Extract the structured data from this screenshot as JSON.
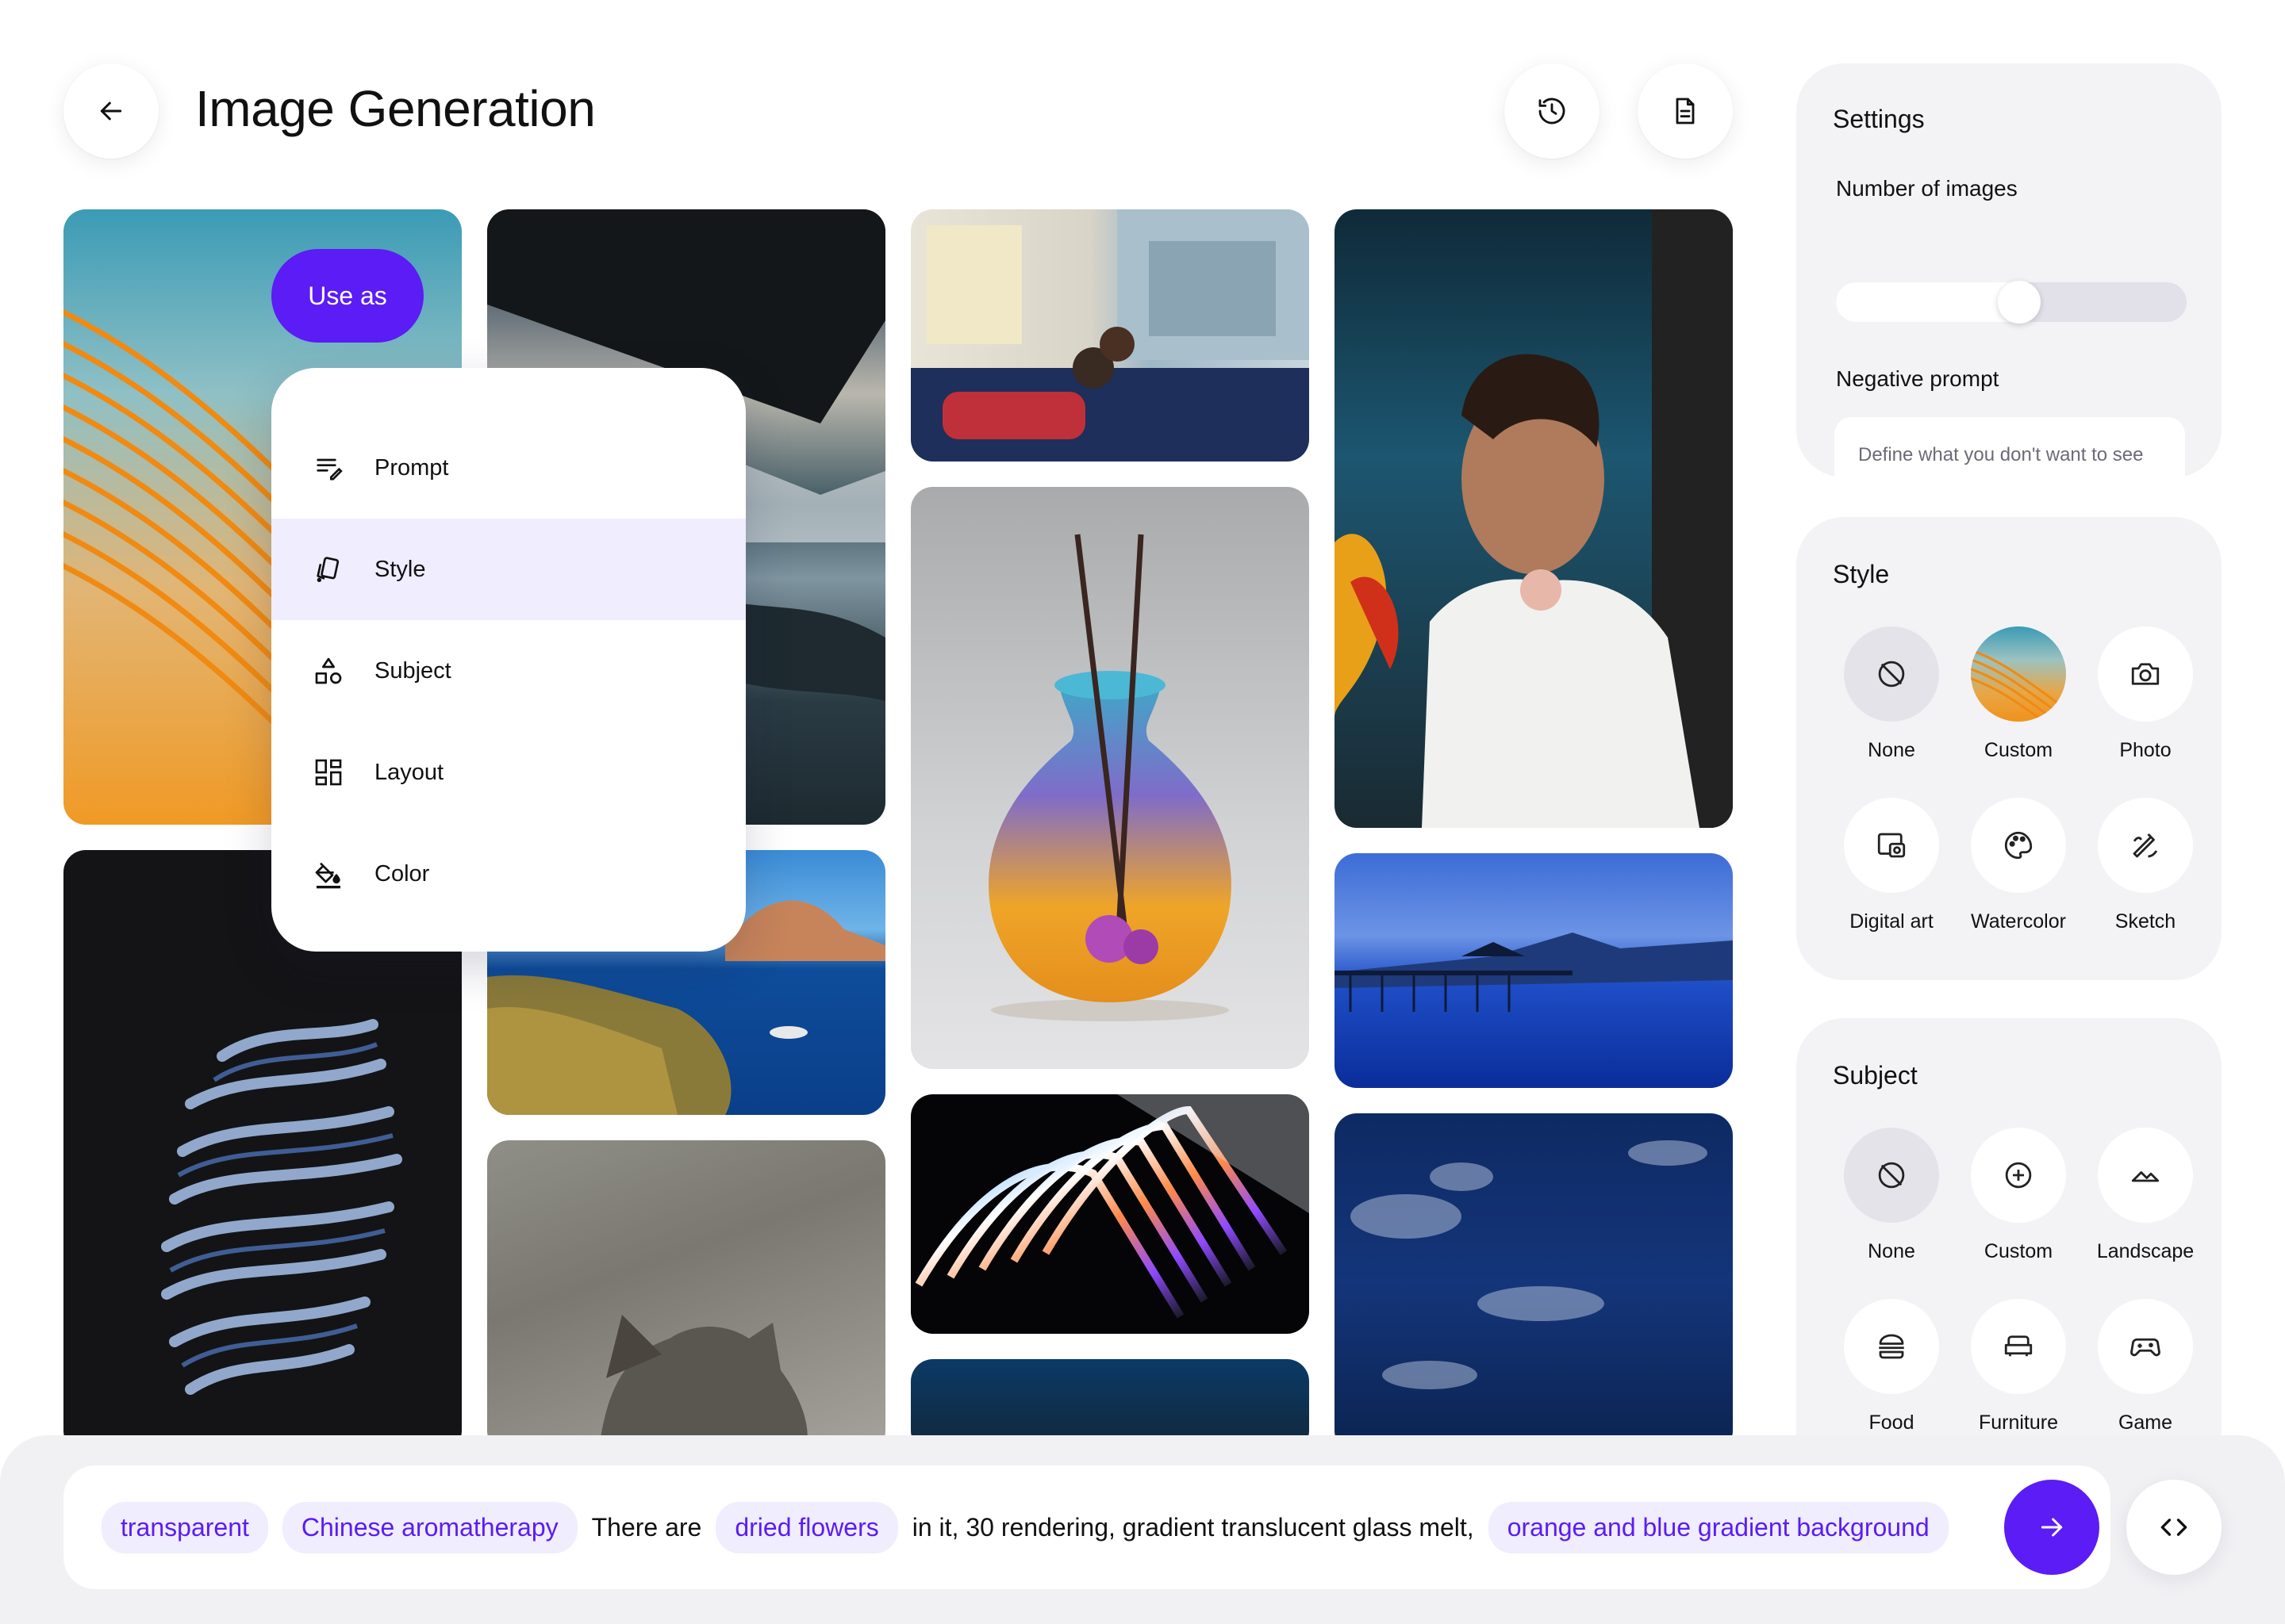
{
  "header": {
    "title": "Image Generation",
    "back_icon": "arrow-left-icon",
    "history_icon": "history-icon",
    "document_icon": "document-icon"
  },
  "gallery": {
    "use_as_label": "Use as"
  },
  "context_menu": {
    "items": [
      {
        "label": "Prompt",
        "icon": "prompt-lines-icon"
      },
      {
        "label": "Style",
        "icon": "style-cards-icon",
        "active": true
      },
      {
        "label": "Subject",
        "icon": "shapes-icon"
      },
      {
        "label": "Layout",
        "icon": "grid-layout-icon"
      },
      {
        "label": "Color",
        "icon": "paint-bucket-icon"
      }
    ]
  },
  "settings": {
    "title": "Settings",
    "num_images_label": "Number of images",
    "num_images_level": 0.5,
    "negative_prompt_label": "Negative prompt",
    "negative_prompt_placeholder": "Define what you don't want to see"
  },
  "style": {
    "title": "Style",
    "options": [
      {
        "label": "None",
        "icon": "none-icon",
        "selected": true
      },
      {
        "label": "Custom",
        "icon": "custom-gradient-thumbnail"
      },
      {
        "label": "Photo",
        "icon": "camera-icon"
      },
      {
        "label": "Digital art",
        "icon": "digital-art-icon"
      },
      {
        "label": "Watercolor",
        "icon": "palette-icon"
      },
      {
        "label": "Sketch",
        "icon": "pencil-sketch-icon"
      }
    ]
  },
  "subject": {
    "title": "Subject",
    "options": [
      {
        "label": "None",
        "icon": "none-icon",
        "selected": true
      },
      {
        "label": "Custom",
        "icon": "plus-circle-icon"
      },
      {
        "label": "Landscape",
        "icon": "mountain-icon"
      },
      {
        "label": "Food",
        "icon": "burger-icon"
      },
      {
        "label": "Furniture",
        "icon": "sofa-icon"
      },
      {
        "label": "Game",
        "icon": "gamepad-icon"
      }
    ]
  },
  "prompt": {
    "chip1": "transparent",
    "chip2": "Chinese aromatherapy",
    "text1": "There are",
    "chip3": "dried flowers",
    "text2": "in it, 30 rendering, gradient translucent glass melt,",
    "chip4": "orange and blue gradient background",
    "send_icon": "arrow-right-icon",
    "code_icon": "code-icon"
  },
  "colors": {
    "accent": "#5b1cf5",
    "chip_bg": "#efedfe",
    "panel_bg": "#f3f3f6"
  }
}
